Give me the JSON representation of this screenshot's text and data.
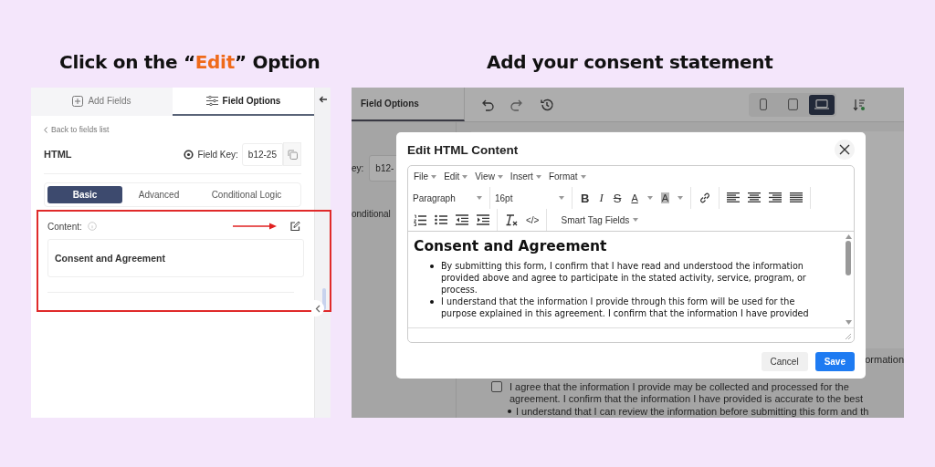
{
  "left_heading": {
    "before": "Click on the “",
    "highlight": "Edit",
    "after": "” Option"
  },
  "right_heading": "Add your consent statement",
  "left_panel": {
    "tabs": [
      {
        "label": "Add Fields",
        "selected": false
      },
      {
        "label": "Field Options",
        "selected": true
      }
    ],
    "back_link": "Back to fields list",
    "field_title": "HTML",
    "field_key_label": "Field Key:",
    "field_key_value": "b12-25",
    "option_tabs": [
      {
        "label": "Basic",
        "selected": true
      },
      {
        "label": "Advanced",
        "selected": false
      },
      {
        "label": "Conditional Logic",
        "selected": false
      }
    ],
    "content_label": "Content:",
    "content_preview": "Consent and Agreement"
  },
  "right_panel": {
    "background": {
      "tab_label": "Field Options",
      "device_buttons": [
        {
          "selected": false
        },
        {
          "selected": false
        },
        {
          "selected": true
        }
      ],
      "field_key_label": "ey:",
      "field_key_value": "b12-",
      "option_text": "onditional",
      "side_text": "ormation",
      "checkbox_text": "I agree that the information I provide may be collected and processed for the",
      "checked": false,
      "line_text": "agreement. I confirm that the information I have provided is accurate to the best",
      "bullet_text": "I understand that I can review the information before submitting this form and th"
    },
    "dialog": {
      "title": "Edit HTML Content",
      "menus": [
        "File",
        "Edit",
        "View",
        "Insert",
        "Format"
      ],
      "block_format": "Paragraph",
      "font_size": "16pt",
      "format_buttons": [
        "B",
        "I",
        "S",
        "A",
        "A"
      ],
      "code_button": "</>",
      "smart_tags": "Smart Tag Fields",
      "content_heading": "Consent and Agreement",
      "bullets": [
        "By submitting this form, I confirm that I have read and understood the information provided above and agree to participate in the stated activity, service, program, or process.",
        "I understand that the information I provide through this form will be used for the purpose explained in this agreement. I confirm that the information I have provided"
      ],
      "buttons": [
        {
          "label": "Cancel",
          "kind": "secondary"
        },
        {
          "label": "Save",
          "kind": "primary"
        }
      ]
    }
  }
}
